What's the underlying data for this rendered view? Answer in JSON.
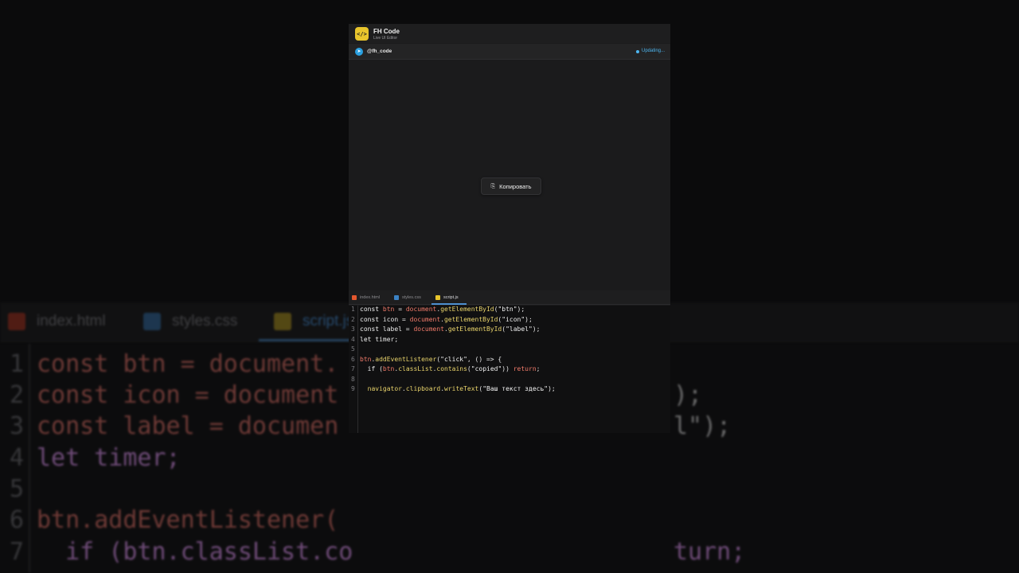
{
  "app": {
    "icon_text": "</>",
    "title": "FH Code",
    "subtitle": "Live UI Editor",
    "handle": "@fh_code",
    "status": "Updating..."
  },
  "preview": {
    "button_icon": "⎘",
    "button_label": "Копировать"
  },
  "tabs": [
    {
      "label": "index.html",
      "color": "#e4572e",
      "active": false
    },
    {
      "label": "styles.css",
      "color": "#3b82c4",
      "active": false
    },
    {
      "label": "script.js",
      "color": "#e8c52c",
      "active": true
    }
  ],
  "code": {
    "line_numbers": [
      "1",
      "2",
      "3",
      "4",
      "5",
      "6",
      "7",
      "8",
      "9"
    ],
    "lines": [
      "const btn = document.getElementById(\"btn\");",
      "const icon = document.getElementById(\"icon\");",
      "const label = document.getElementById(\"label\");",
      "let timer;",
      "",
      "btn.addEventListener(\"click\", () => {",
      "  if (btn.classList.contains(\"copied\")) return;",
      "",
      "  navigator.clipboard.writeText(\"Ваш текст здесь\");"
    ]
  },
  "background": {
    "tabs": [
      "index.html",
      "styles.css",
      "script.js"
    ],
    "line_numbers": [
      "1",
      "2",
      "3",
      "4",
      "5",
      "6",
      "7"
    ],
    "left_lines": [
      "const btn = document.",
      "const icon = document",
      "const label = documen",
      "let timer;",
      "",
      "btn.addEventListener(",
      "  if (btn.classList.co"
    ],
    "right_fragments": [
      ");",
      "l\");",
      "turn;"
    ]
  }
}
